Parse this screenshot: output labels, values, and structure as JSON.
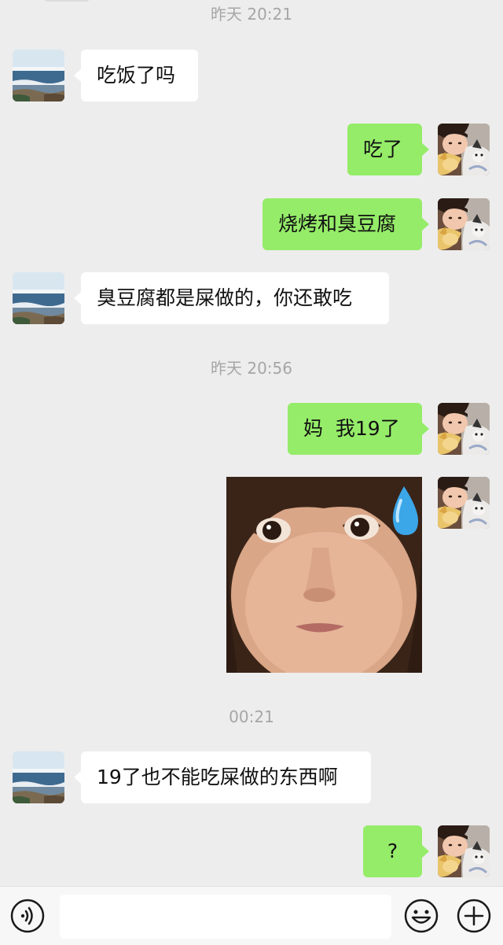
{
  "chat": {
    "timestamps": [
      "昨天 20:21",
      "昨天 20:56",
      "00:21"
    ],
    "messages": [
      {
        "sender": "other",
        "text": "吃饭了吗"
      },
      {
        "sender": "me",
        "text": "吃了"
      },
      {
        "sender": "me",
        "text": "烧烤和臭豆腐"
      },
      {
        "sender": "other",
        "text": "臭豆腐都是屎做的，你还敢吃"
      },
      {
        "sender": "me",
        "text": "妈  我19了"
      },
      {
        "sender": "me",
        "type": "sticker",
        "description_icon": "crying-child-sticker"
      },
      {
        "sender": "other",
        "text": "19了也不能吃屎做的东西啊"
      },
      {
        "sender": "me",
        "text": "?"
      }
    ]
  },
  "avatars": {
    "other": "beach-avatar-icon",
    "me": "girl-with-cat-avatar-icon"
  },
  "input_bar": {
    "icons": [
      "voice-icon",
      "emoji-icon",
      "plus-icon"
    ]
  },
  "colors": {
    "background": "#ededed",
    "incoming_bubble": "#ffffff",
    "outgoing_bubble": "#95ec69",
    "timestamp_text": "#a6a6a6"
  }
}
